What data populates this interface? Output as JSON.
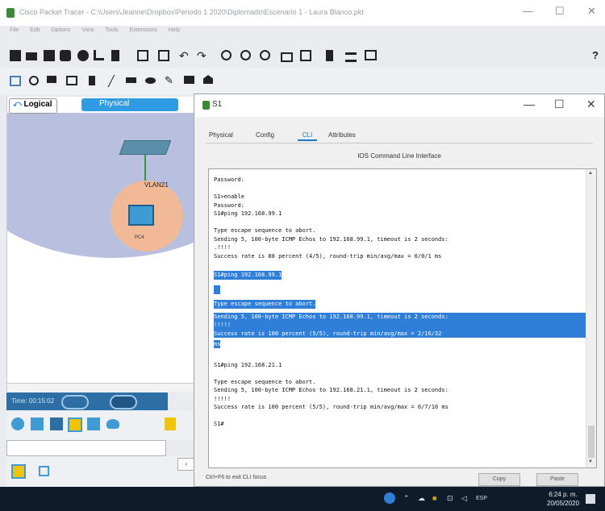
{
  "window": {
    "title": "Cisco Packet Tracer - C:\\Users\\Jeanne\\Dropbox\\Periodo 1 2020\\Diplomado\\Escenario 1 - Laura Blanco.pkt",
    "min": "—",
    "max": "☐",
    "close": "✕"
  },
  "menu": {
    "items": [
      "File",
      "Edit",
      "Options",
      "View",
      "Tools",
      "Extensions",
      "Help"
    ]
  },
  "toolbar": {
    "help": "?"
  },
  "workspace": {
    "logical_tab": "Logical",
    "physical_tab": "Physical",
    "vlan_label": "VLAN21",
    "pc_label": "PC4"
  },
  "bottom": {
    "time": "Time: 00:15:02"
  },
  "dialog": {
    "title": "S1",
    "min": "—",
    "max": "☐",
    "close": "✕",
    "tabs": [
      "Physical",
      "Config",
      "CLI",
      "Attributes"
    ],
    "header": "IOS Command Line Interface",
    "footer_hint": "Ctrl+F6 to exit CLI focus",
    "copy_button": "Copy",
    "paste_button": "Paste"
  },
  "console": {
    "lines": [
      {
        "text": "Password:",
        "sel": false
      },
      {
        "text": "",
        "sel": false
      },
      {
        "text": "S1>enable",
        "sel": false
      },
      {
        "text": "Password:",
        "sel": false
      },
      {
        "text": "S1#ping 192.168.99.1",
        "sel": false
      },
      {
        "text": "",
        "sel": false
      },
      {
        "text": "Type escape sequence to abort.",
        "sel": false
      },
      {
        "text": "Sending 5, 100-byte ICMP Echos to 192.168.99.1, timeout is 2 seconds:",
        "sel": false
      },
      {
        "text": ".!!!!",
        "sel": false
      },
      {
        "text": "Success rate is 80 percent (4/5), round-trip min/avg/max = 0/0/1 ms",
        "sel": false
      },
      {
        "text": "",
        "sel": false
      },
      {
        "text": "S1#ping 192.168.99.1",
        "sel": true,
        "short": true
      },
      {
        "text": "",
        "sel": true,
        "short": true
      },
      {
        "text": "Type escape sequence to abort.",
        "sel": true,
        "short": true
      },
      {
        "text": "Sending 5, 100-byte ICMP Echos to 192.168.99.1, timeout is 2 seconds:",
        "sel": true
      },
      {
        "text": "!!!!!",
        "sel": true
      },
      {
        "text": "Success rate is 100 percent (5/5), round-trip min/avg/max = 2/16/32",
        "sel": true
      },
      {
        "text": "ms",
        "sel": true,
        "short": true
      },
      {
        "text": "",
        "sel": false
      },
      {
        "text": "S1#ping 192.168.21.1",
        "sel": false
      },
      {
        "text": "",
        "sel": false
      },
      {
        "text": "Type escape sequence to abort.",
        "sel": false
      },
      {
        "text": "Sending 5, 100-byte ICMP Echos to 192.168.21.1, timeout is 2 seconds:",
        "sel": false
      },
      {
        "text": "!!!!!",
        "sel": false
      },
      {
        "text": "Success rate is 100 percent (5/5), round-trip min/avg/max = 0/7/10 ms",
        "sel": false
      },
      {
        "text": "",
        "sel": false
      },
      {
        "text": "S1#",
        "sel": false
      }
    ]
  },
  "taskbar": {
    "lang": "ESP",
    "time": "6:24 p. m.",
    "date": "20/05/2020"
  },
  "colors": {
    "selection": "#2f7ed8",
    "physical_tab": "#2f9be3",
    "taskbar": "#0e1b2a"
  }
}
